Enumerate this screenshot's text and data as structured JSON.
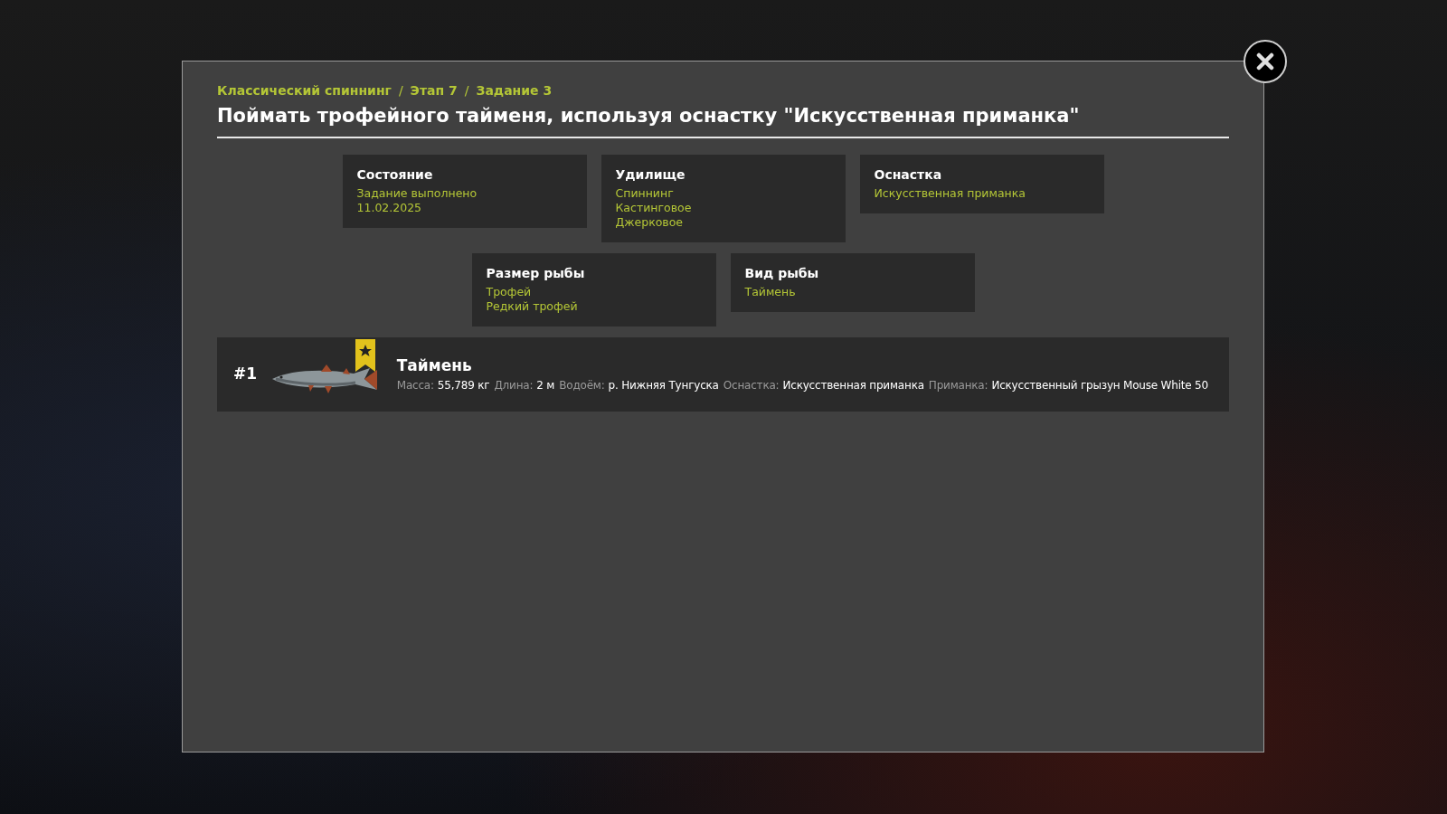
{
  "breadcrumb": [
    "Классический спиннинг",
    "Этап 7",
    "Задание 3"
  ],
  "breadcrumb_separator": "/",
  "title": "Поймать трофейного тайменя, используя оснастку \"Искусственная приманка\"",
  "condition_rows": [
    [
      {
        "title": "Состояние",
        "values": [
          "Задание выполнено",
          "11.02.2025"
        ]
      },
      {
        "title": "Удилище",
        "values": [
          "Спиннинг",
          "Кастинговое",
          "Джерковое"
        ]
      },
      {
        "title": "Оснастка",
        "values": [
          "Искусственная приманка"
        ]
      }
    ],
    [
      {
        "title": "Размер рыбы",
        "values": [
          "Трофей",
          "Редкий трофей"
        ]
      },
      {
        "title": "Вид рыбы",
        "values": [
          "Таймень"
        ]
      }
    ]
  ],
  "catches": [
    {
      "rank": "#1",
      "name": "Таймень",
      "trophy": true,
      "details": [
        {
          "label": "Масса:",
          "value": "55,789 кг"
        },
        {
          "label": "Длина:",
          "value": "2 м"
        },
        {
          "label": "Водоём:",
          "value": "р. Нижняя Тунгуска"
        },
        {
          "label": "Оснастка:",
          "value": "Искусственная приманка"
        },
        {
          "label": "Приманка:",
          "value": "Искусственный грызун Mouse White 50"
        }
      ]
    }
  ]
}
